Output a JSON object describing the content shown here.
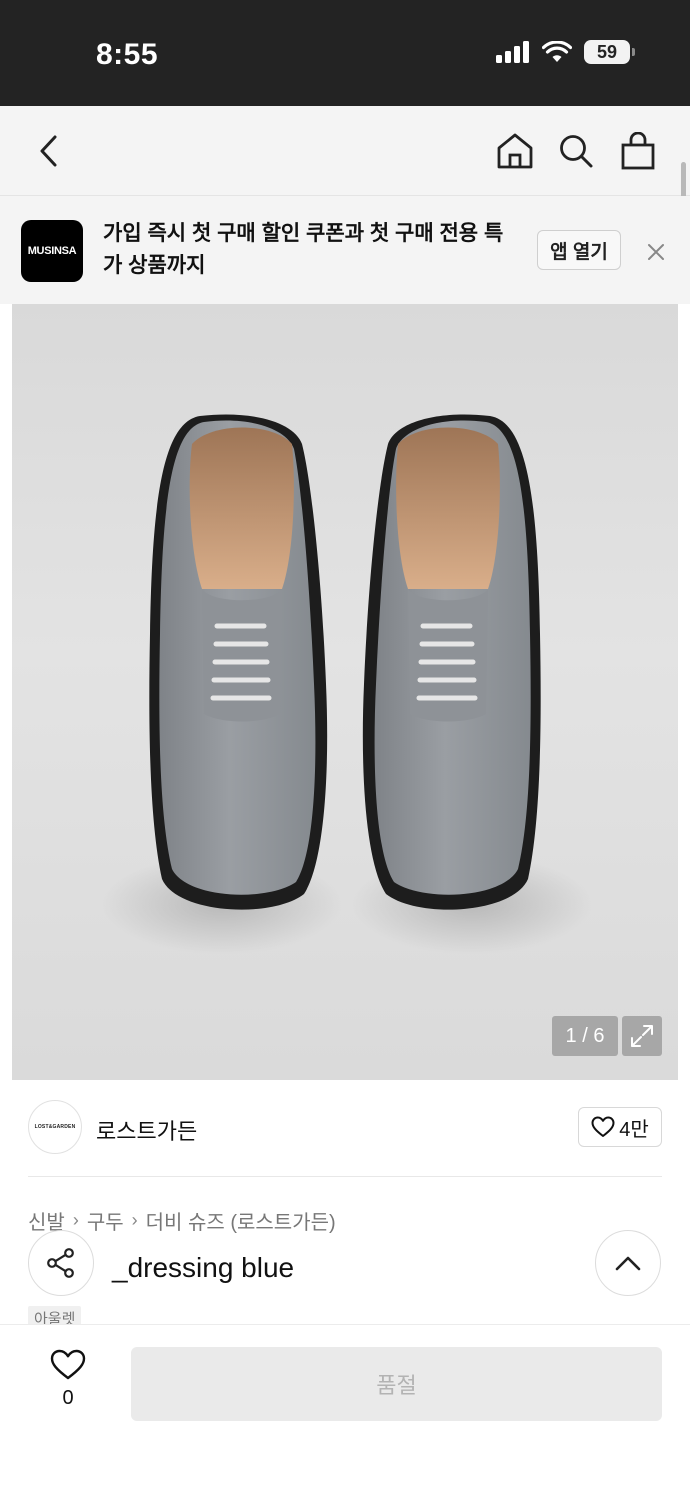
{
  "status_bar": {
    "time": "8:55",
    "battery": "59"
  },
  "promo": {
    "logo_text": "MUSINSA",
    "message": "가입 즉시 첫 구매 할인 쿠폰과 첫 구매 전용 특가 상품까지",
    "open_label": "앱 열기"
  },
  "gallery": {
    "counter": "1 / 6"
  },
  "brand": {
    "logo_text": "LOST&GARDEN",
    "name": "로스트가든",
    "likes": "4만"
  },
  "breadcrumb": [
    "신발",
    "구두",
    "더비 슈즈 (로스트가든)"
  ],
  "product": {
    "name": "_dressing blue",
    "tag": "아울렛"
  },
  "bottom": {
    "wish_count": "0",
    "buy_label": "품절"
  },
  "colors": {
    "status_bar_bg": "#232323",
    "header_bg": "#f4f4f4",
    "disabled_button": "#eaeaea"
  }
}
